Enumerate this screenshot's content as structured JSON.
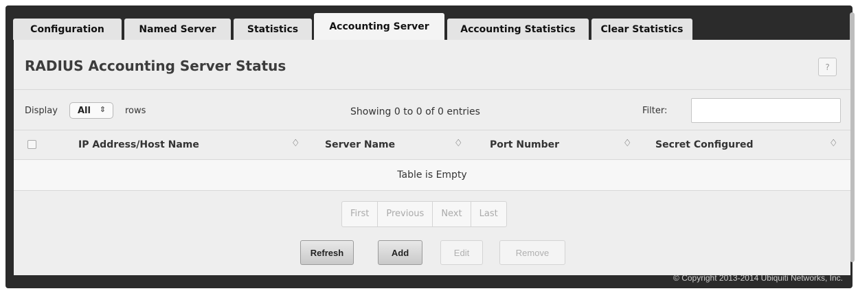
{
  "tabs": [
    {
      "label": "Configuration",
      "active": false
    },
    {
      "label": "Named Server",
      "active": false
    },
    {
      "label": "Statistics",
      "active": false
    },
    {
      "label": "Accounting Server",
      "active": true
    },
    {
      "label": "Accounting Statistics",
      "active": false
    },
    {
      "label": "Clear Statistics",
      "active": false
    }
  ],
  "page": {
    "title": "RADIUS Accounting Server Status",
    "help_label": "?"
  },
  "table_controls": {
    "display_label": "Display",
    "rows_selected": "All",
    "rows_label": "rows",
    "showing_text": "Showing 0 to 0 of 0 entries",
    "filter_label": "Filter:",
    "filter_value": ""
  },
  "table": {
    "columns": [
      "IP Address/Host Name",
      "Server Name",
      "Port Number",
      "Secret Configured"
    ],
    "sort_glyph": "♢",
    "empty_text": "Table is Empty"
  },
  "pagination": {
    "first": "First",
    "previous": "Previous",
    "next": "Next",
    "last": "Last"
  },
  "actions": {
    "refresh": "Refresh",
    "add": "Add",
    "edit": "Edit",
    "remove": "Remove"
  },
  "footer": {
    "copyright": "© Copyright 2013-2014 Ubiquiti Networks, Inc."
  },
  "colors": {
    "frame": "#2b2b2b",
    "panel": "#eeeeee",
    "tab": "#e4e4e4",
    "active_tab": "#f4f4f4"
  }
}
